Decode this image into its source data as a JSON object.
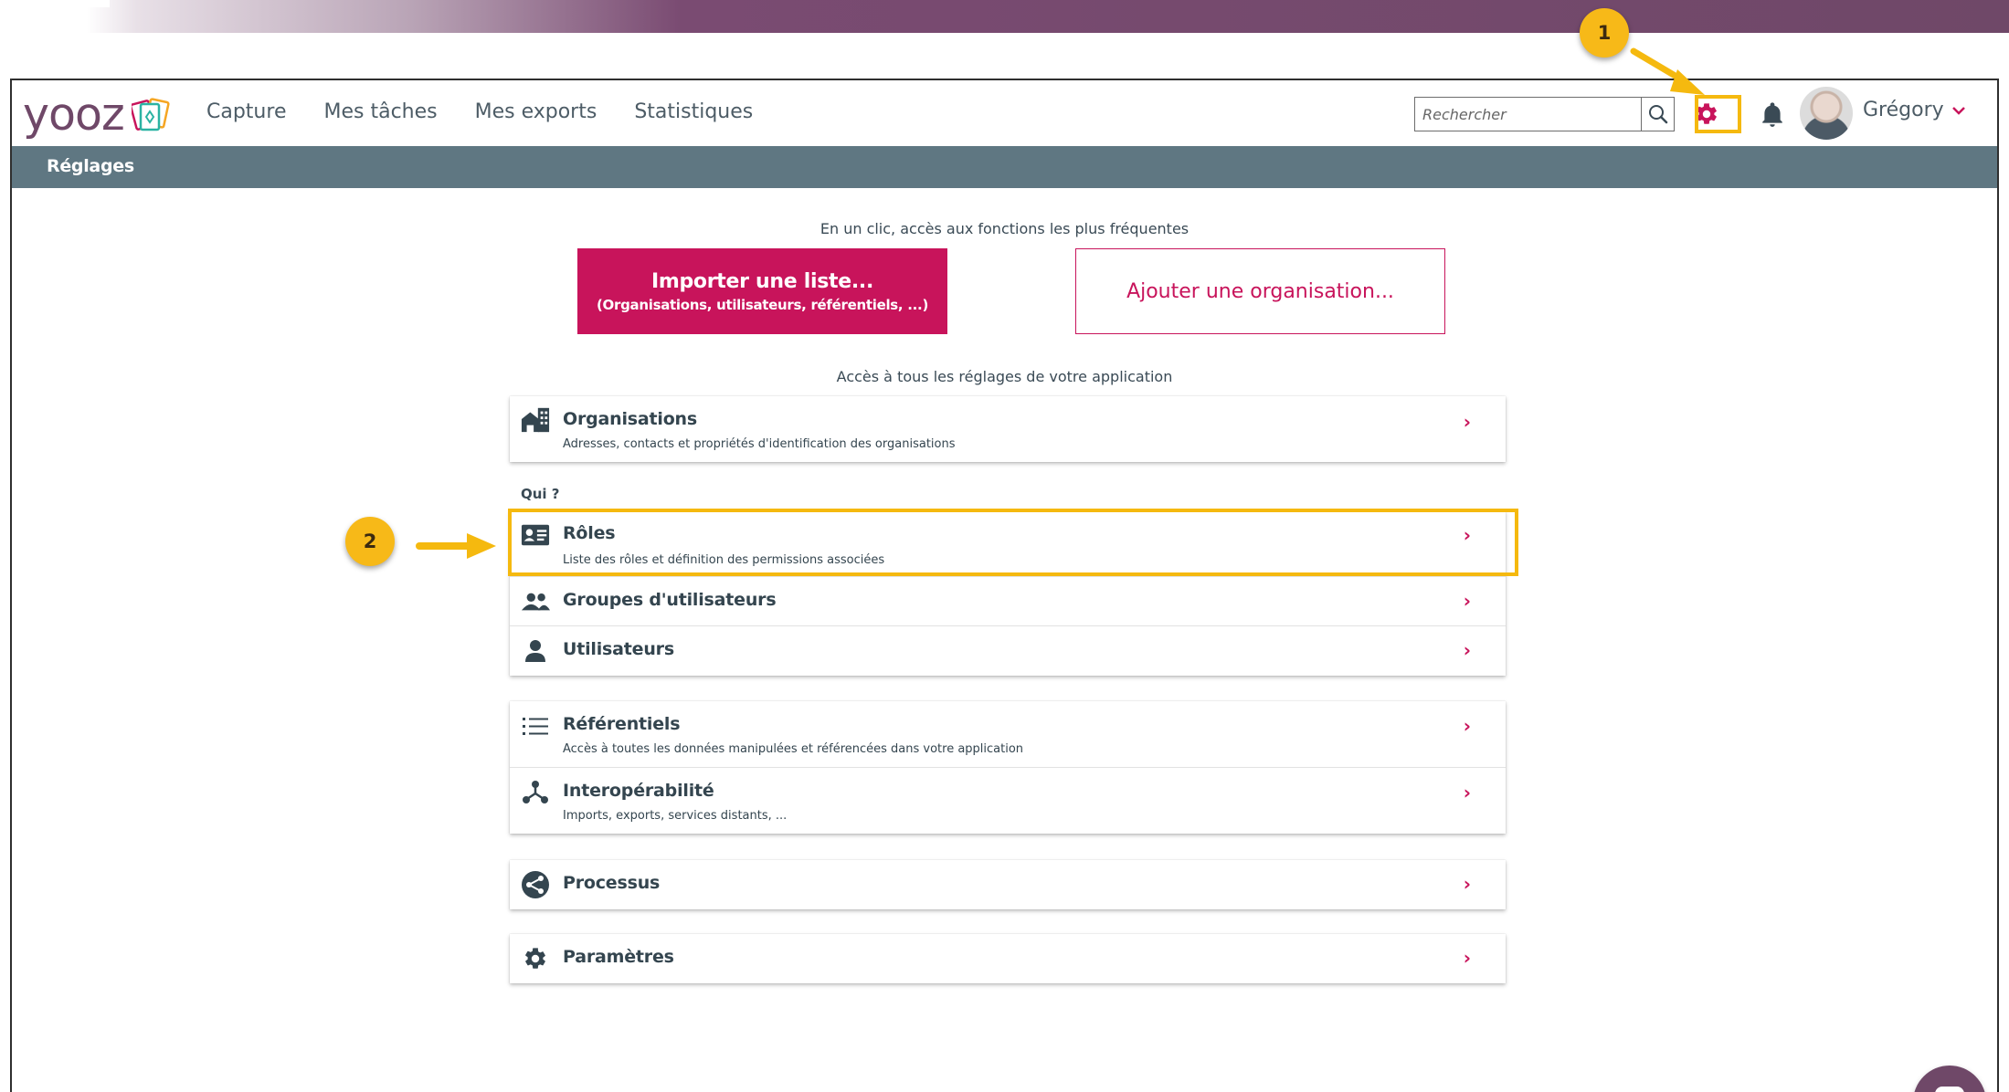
{
  "app": {
    "logo_text": "yooz"
  },
  "nav": {
    "items": [
      "Capture",
      "Mes tâches",
      "Mes exports",
      "Statistiques"
    ]
  },
  "search": {
    "placeholder": "Rechercher"
  },
  "user": {
    "name": "Grégory"
  },
  "subbar": {
    "title": "Réglages"
  },
  "quick": {
    "label": "En un clic, accès aux fonctions les plus fréquentes",
    "import_title": "Importer une liste...",
    "import_sub": "(Organisations, utilisateurs, référentiels, ...)",
    "add_org": "Ajouter une organisation..."
  },
  "settings": {
    "label": "Accès à tous les réglages de votre application",
    "qui_label": "Qui ?",
    "organisations": {
      "title": "Organisations",
      "desc": "Adresses, contacts et propriétés d'identification des organisations"
    },
    "roles": {
      "title": "Rôles",
      "desc": "Liste des rôles et définition des permissions associées"
    },
    "groupes": {
      "title": "Groupes d'utilisateurs"
    },
    "utilisateurs": {
      "title": "Utilisateurs"
    },
    "referentiels": {
      "title": "Référentiels",
      "desc": "Accès à toutes les données manipulées et référencées dans votre application"
    },
    "interop": {
      "title": "Interopérabilité",
      "desc": "Imports, exports, services distants, ..."
    },
    "processus": {
      "title": "Processus"
    },
    "parametres": {
      "title": "Paramètres"
    },
    "chevron": "›"
  },
  "annotations": {
    "step1": "1",
    "step2": "2"
  },
  "colors": {
    "brand": "#6f4868",
    "accent": "#c8145b",
    "subbar": "#5f7782",
    "highlight": "#f5b90f"
  }
}
